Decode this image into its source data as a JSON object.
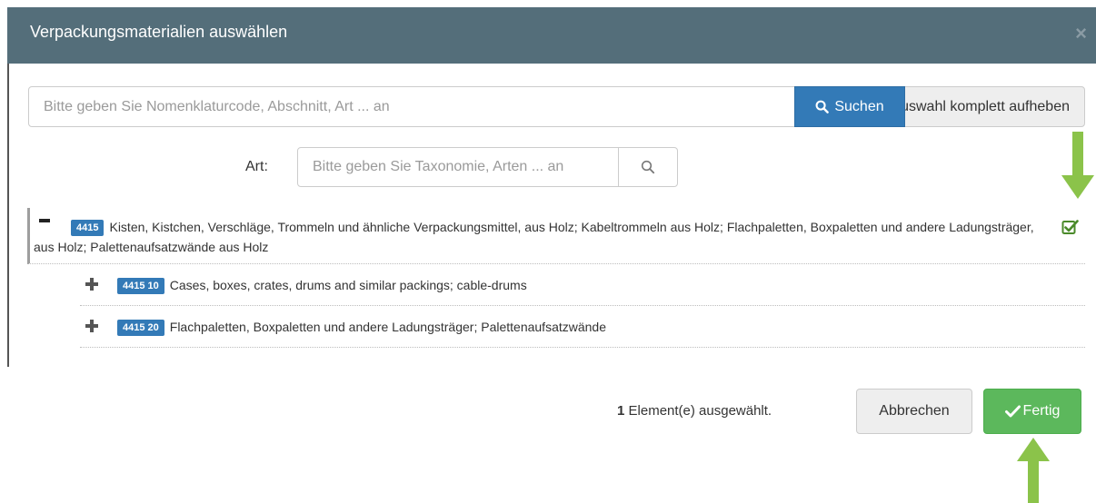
{
  "modal": {
    "title": "Verpackungsmaterialien auswählen",
    "close_symbol": "×"
  },
  "search": {
    "placeholder": "Bitte geben Sie Nomenklaturcode, Abschnitt, Art ... an",
    "button_label": "Suchen",
    "button_icon": "search-icon",
    "clear_label": "Auswahl komplett aufheben"
  },
  "art_filter": {
    "label": "Art:",
    "placeholder": "Bitte geben Sie Taxonomie, Arten ... an",
    "button_icon": "search-icon"
  },
  "tree": {
    "parent": {
      "code": "4415",
      "text": "Kisten, Kistchen, Verschläge, Trommeln und ähnliche Verpackungsmittel, aus Holz; Kabeltrommeln aus Holz; Flachpaletten, Boxpaletten und andere Ladungsträger, aus Holz; Palettenaufsatzwände aus Holz",
      "expanded": true,
      "checked": true
    },
    "children": [
      {
        "code": "4415 10",
        "text": "Cases, boxes, crates, drums and similar packings; cable-drums"
      },
      {
        "code": "4415 20",
        "text": "Flachpaletten, Boxpaletten und andere Ladungsträger; Palettenaufsatzwände"
      }
    ]
  },
  "footer": {
    "selected_count": "1",
    "selected_text": "Element(e) ausgewählt.",
    "cancel_label": "Abbrechen",
    "done_label": "Fertig",
    "done_icon": "checkmark-icon"
  },
  "colors": {
    "header_bg": "#546e7a",
    "primary": "#337ab7",
    "success": "#5cb85c",
    "annotation_arrow": "#8bc34a"
  }
}
